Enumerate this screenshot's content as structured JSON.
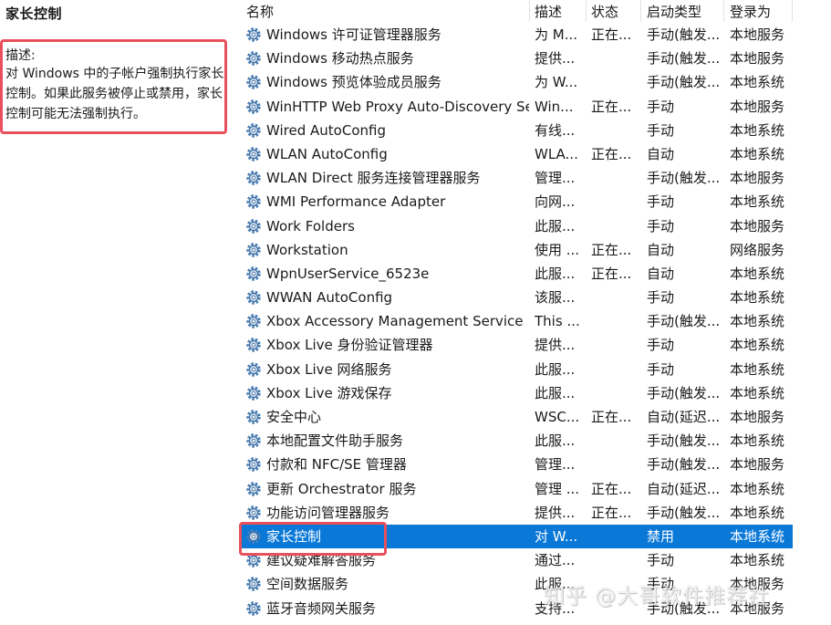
{
  "detail": {
    "service_name": "家长控制",
    "desc_label": "描述:",
    "desc_text": "对 Windows 中的子帐户强制执行家长控制。如果此服务被停止或禁用，家长控制可能无法强制执行。"
  },
  "columns": {
    "name": "名称",
    "description": "描述",
    "status": "状态",
    "startup": "启动类型",
    "logon": "登录为"
  },
  "services": [
    {
      "name": "Windows 许可证管理器服务",
      "description": "为 M...",
      "status": "正在...",
      "startup": "手动(触发...",
      "logon": "本地服务"
    },
    {
      "name": "Windows 移动热点服务",
      "description": "提供...",
      "status": "",
      "startup": "手动(触发...",
      "logon": "本地服务"
    },
    {
      "name": "Windows 预览体验成员服务",
      "description": "为 W...",
      "status": "",
      "startup": "手动(触发...",
      "logon": "本地系统"
    },
    {
      "name": "WinHTTP Web Proxy Auto-Discovery Se...",
      "description": "Win...",
      "status": "正在...",
      "startup": "手动",
      "logon": "本地服务"
    },
    {
      "name": "Wired AutoConfig",
      "description": "有线...",
      "status": "",
      "startup": "手动",
      "logon": "本地系统"
    },
    {
      "name": "WLAN AutoConfig",
      "description": "WLA...",
      "status": "正在...",
      "startup": "自动",
      "logon": "本地系统"
    },
    {
      "name": "WLAN Direct 服务连接管理器服务",
      "description": "管理...",
      "status": "",
      "startup": "手动(触发...",
      "logon": "本地服务"
    },
    {
      "name": "WMI Performance Adapter",
      "description": "向网...",
      "status": "",
      "startup": "手动",
      "logon": "本地系统"
    },
    {
      "name": "Work Folders",
      "description": "此服...",
      "status": "",
      "startup": "手动",
      "logon": "本地服务"
    },
    {
      "name": "Workstation",
      "description": "使用 ...",
      "status": "正在...",
      "startup": "自动",
      "logon": "网络服务"
    },
    {
      "name": "WpnUserService_6523e",
      "description": "此服...",
      "status": "正在...",
      "startup": "自动",
      "logon": "本地系统"
    },
    {
      "name": "WWAN AutoConfig",
      "description": "该服...",
      "status": "",
      "startup": "手动",
      "logon": "本地系统"
    },
    {
      "name": "Xbox Accessory Management Service",
      "description": "This ...",
      "status": "",
      "startup": "手动(触发...",
      "logon": "本地系统"
    },
    {
      "name": "Xbox Live 身份验证管理器",
      "description": "提供...",
      "status": "",
      "startup": "手动",
      "logon": "本地系统"
    },
    {
      "name": "Xbox Live 网络服务",
      "description": "此服...",
      "status": "",
      "startup": "手动",
      "logon": "本地系统"
    },
    {
      "name": "Xbox Live 游戏保存",
      "description": "此服...",
      "status": "",
      "startup": "手动(触发...",
      "logon": "本地系统"
    },
    {
      "name": "安全中心",
      "description": "WSC...",
      "status": "正在...",
      "startup": "自动(延迟...",
      "logon": "本地服务"
    },
    {
      "name": "本地配置文件助手服务",
      "description": "此服...",
      "status": "",
      "startup": "手动(触发...",
      "logon": "本地系统"
    },
    {
      "name": "付款和 NFC/SE 管理器",
      "description": "管理...",
      "status": "",
      "startup": "手动(触发...",
      "logon": "本地服务"
    },
    {
      "name": "更新 Orchestrator 服务",
      "description": "管理 ...",
      "status": "正在...",
      "startup": "自动(延迟...",
      "logon": "本地系统"
    },
    {
      "name": "功能访问管理器服务",
      "description": "提供...",
      "status": "正在...",
      "startup": "手动(触发...",
      "logon": "本地系统"
    },
    {
      "name": "家长控制",
      "description": "对 W...",
      "status": "",
      "startup": "禁用",
      "logon": "本地系统",
      "selected": true
    },
    {
      "name": "建议疑难解答服务",
      "description": "通过...",
      "status": "",
      "startup": "手动",
      "logon": "本地系统"
    },
    {
      "name": "空间数据服务",
      "description": "此服...",
      "status": "",
      "startup": "手动",
      "logon": "本地服务"
    },
    {
      "name": "蓝牙音频网关服务",
      "description": "支持...",
      "status": "",
      "startup": "手动(触发...",
      "logon": "本地服务"
    }
  ],
  "watermark": "知乎 @大哥软件推荐社",
  "colors": {
    "selection": "#0a78d7",
    "highlight_border": "#e8505b",
    "gear": "#4a7fb5"
  },
  "icons": {
    "service": "gear-icon"
  }
}
